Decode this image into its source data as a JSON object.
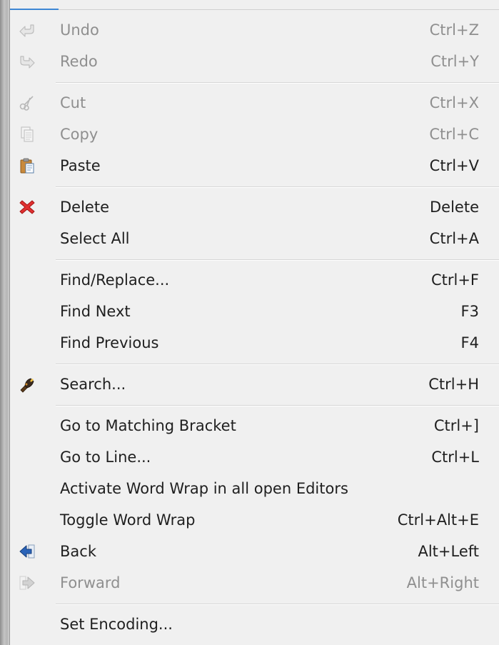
{
  "menu": {
    "items": [
      {
        "id": "undo",
        "label": "Undo",
        "shortcut": "Ctrl+Z",
        "icon": "undo-icon",
        "enabled": false
      },
      {
        "id": "redo",
        "label": "Redo",
        "shortcut": "Ctrl+Y",
        "icon": "redo-icon",
        "enabled": false
      },
      {
        "id": "cut",
        "label": "Cut",
        "shortcut": "Ctrl+X",
        "icon": "scissors-icon",
        "enabled": false
      },
      {
        "id": "copy",
        "label": "Copy",
        "shortcut": "Ctrl+C",
        "icon": "copy-icon",
        "enabled": false
      },
      {
        "id": "paste",
        "label": "Paste",
        "shortcut": "Ctrl+V",
        "icon": "clipboard-paste-icon",
        "enabled": true
      },
      {
        "id": "delete",
        "label": "Delete",
        "shortcut": "Delete",
        "icon": "red-x-delete-icon",
        "enabled": true
      },
      {
        "id": "select-all",
        "label": "Select All",
        "shortcut": "Ctrl+A",
        "icon": "",
        "enabled": true
      },
      {
        "id": "find-replace",
        "label": "Find/Replace...",
        "shortcut": "Ctrl+F",
        "icon": "",
        "enabled": true
      },
      {
        "id": "find-next",
        "label": "Find Next",
        "shortcut": "F3",
        "icon": "",
        "enabled": true
      },
      {
        "id": "find-previous",
        "label": "Find Previous",
        "shortcut": "F4",
        "icon": "",
        "enabled": true
      },
      {
        "id": "search",
        "label": "Search...",
        "shortcut": "Ctrl+H",
        "icon": "flashlight-search-icon",
        "enabled": true
      },
      {
        "id": "go-to-matching-bracket",
        "label": "Go to Matching Bracket",
        "shortcut": "Ctrl+]",
        "icon": "",
        "enabled": true
      },
      {
        "id": "go-to-line",
        "label": "Go to Line...",
        "shortcut": "Ctrl+L",
        "icon": "",
        "enabled": true
      },
      {
        "id": "activate-word-wrap",
        "label": "Activate Word Wrap in all open Editors",
        "shortcut": "",
        "icon": "",
        "enabled": true
      },
      {
        "id": "toggle-word-wrap",
        "label": "Toggle Word Wrap",
        "shortcut": "Ctrl+Alt+E",
        "icon": "",
        "enabled": true
      },
      {
        "id": "back",
        "label": "Back",
        "shortcut": "Alt+Left",
        "icon": "back-arrow-icon",
        "enabled": true
      },
      {
        "id": "forward",
        "label": "Forward",
        "shortcut": "Alt+Right",
        "icon": "forward-arrow-icon",
        "enabled": false
      },
      {
        "id": "set-encoding",
        "label": "Set Encoding...",
        "shortcut": "",
        "icon": "",
        "enabled": true
      }
    ]
  }
}
